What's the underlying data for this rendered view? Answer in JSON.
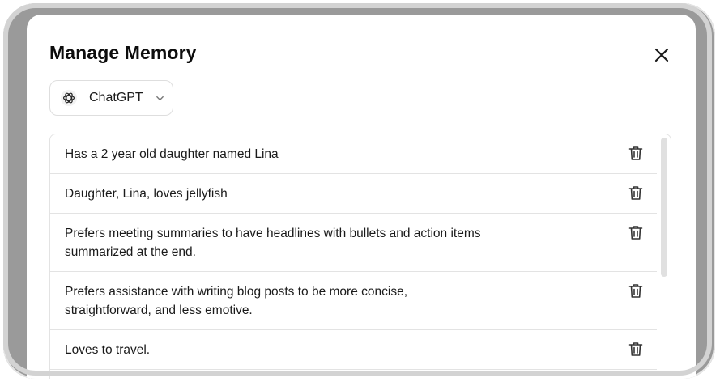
{
  "modal": {
    "title": "Manage Memory",
    "close_icon": "close-icon"
  },
  "selector": {
    "label": "ChatGPT",
    "logo_icon": "chatgpt-logo-icon",
    "chevron_icon": "chevron-down-icon"
  },
  "memories": [
    {
      "text": "Has a 2 year old daughter named Lina",
      "delete_icon": "trash-icon"
    },
    {
      "text": "Daughter, Lina, loves jellyfish",
      "delete_icon": "trash-icon"
    },
    {
      "text": "Prefers meeting summaries to have headlines with bullets and action items summarized at the end.",
      "delete_icon": "trash-icon"
    },
    {
      "text": "Prefers assistance with writing blog posts to be more concise, straightforward, and less emotive.",
      "delete_icon": "trash-icon"
    },
    {
      "text": "Loves to travel.",
      "delete_icon": "trash-icon"
    }
  ]
}
